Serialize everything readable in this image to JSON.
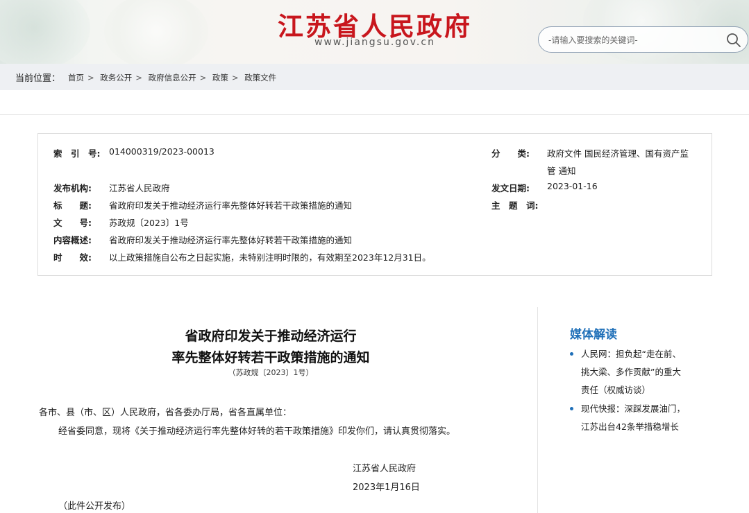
{
  "header": {
    "title": "江苏省人民政府",
    "url": "www.jiangsu.gov.cn",
    "search_placeholder": "-请输入要搜索的关键词-"
  },
  "breadcrumb": {
    "label": "当前位置：",
    "items": [
      "首页",
      "政务公开",
      "政府信息公开",
      "政策",
      "政策文件"
    ]
  },
  "meta": {
    "index_label": "索　引　号:",
    "index_value": "014000319/2023-00013",
    "category_label": "分　　类:",
    "category_value_1": "政府文件 国民经济管理、国有资产监",
    "category_value_2": "管 通知",
    "issuer_label": "发布机构:",
    "issuer_value": "江苏省人民政府",
    "date_label": "发文日期:",
    "date_value": "2023-01-16",
    "title_label": "标　　题:",
    "title_value": "省政府印发关于推动经济运行率先整体好转若干政策措施的通知",
    "subject_label": "主　题　词:",
    "subject_value": "",
    "docno_label": "文　　号:",
    "docno_value": "苏政规〔2023〕1号",
    "summary_label": "内容概述:",
    "summary_value": "省政府印发关于推动经济运行率先整体好转若干政策措施的通知",
    "validity_label": "时　　效:",
    "validity_value": "以上政策措施自公布之日起实施，未特别注明时限的，有效期至2023年12月31日。"
  },
  "article": {
    "title_line1": "省政府印发关于推动经济运行",
    "title_line2": "率先整体好转若干政策措施的通知",
    "doc_no": "（苏政规〔2023〕1号）",
    "salutation": "各市、县（市、区）人民政府，省各委办厅局，省各直属单位：",
    "body": "经省委同意，现将《关于推动经济运行率先整体好转的若干政策措施》印发你们，请认真贯彻落实。",
    "signer": "江苏省人民政府",
    "sign_date": "2023年1月16日",
    "note": "（此件公开发布）"
  },
  "sidebar": {
    "title": "媒体解读",
    "items": [
      {
        "lines": [
          "人民网：担负起“走在前、",
          "挑大梁、多作贡献”的重大",
          "责任（权威访谈）"
        ]
      },
      {
        "lines": [
          "现代快报：深踩发展油门，",
          "江苏出台42条举措稳增长"
        ]
      }
    ]
  },
  "colors": {
    "brand_red": "#c8161d",
    "link_blue": "#1e6fb8",
    "breadcrumb_bg": "#eef0f3"
  },
  "icons": {
    "search": "search-icon",
    "bullet": "bullet-icon"
  }
}
